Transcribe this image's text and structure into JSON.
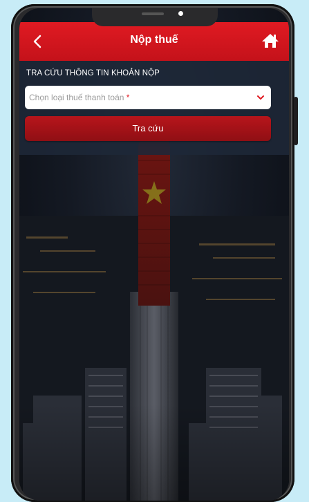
{
  "header": {
    "title": "Nộp thuế",
    "back_icon": "chevron-left-icon",
    "home_icon": "home-icon",
    "background_color": "#d7151d"
  },
  "search": {
    "section_title": "TRA CỨU THÔNG TIN KHOẢN NỘP",
    "tax_type_placeholder": "Chọn loại thuế thanh toán",
    "required_mark": "*",
    "dropdown_icon": "chevron-down-icon",
    "lookup_button_label": "Tra cứu",
    "button_color": "#a5121a"
  },
  "colors": {
    "page_background": "#c8ecf7",
    "accent_red": "#e01a22",
    "panel_background": "#1e2838"
  }
}
